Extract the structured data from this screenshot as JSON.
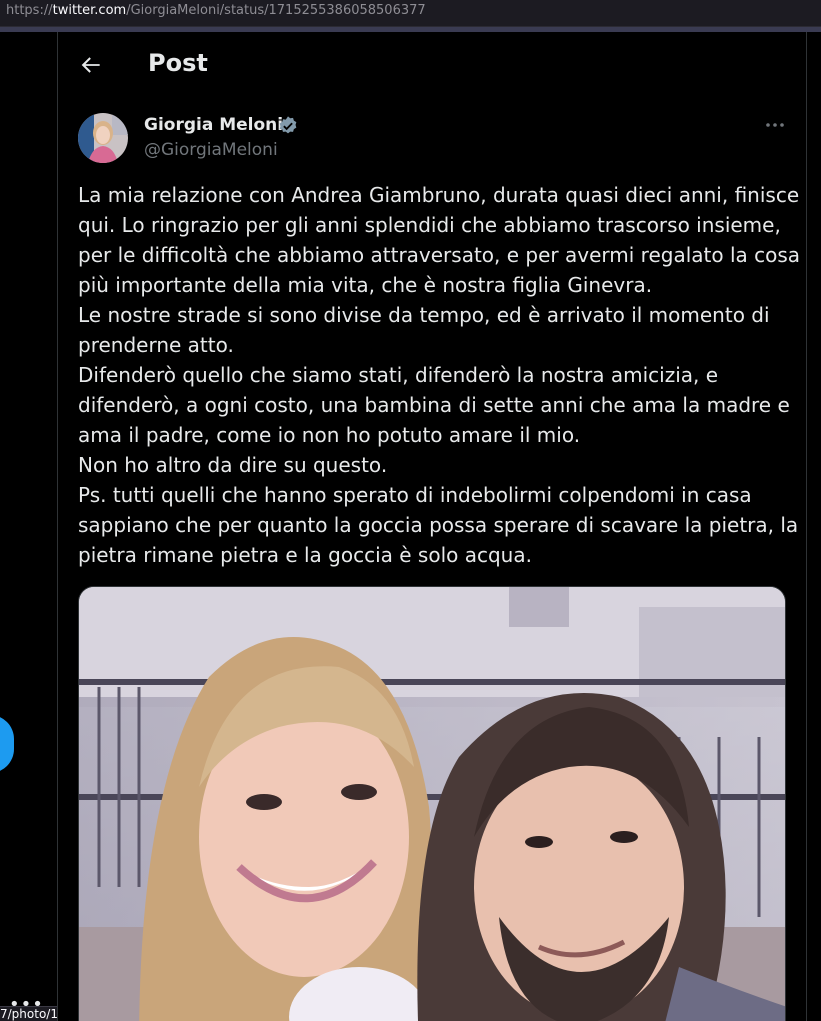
{
  "browser": {
    "url_prefix": "https://",
    "url_host": "twitter.com",
    "url_path": "/GiorgiaMeloni/status/1715255386058506377",
    "status_link": "7/photo/1"
  },
  "header": {
    "title": "Post",
    "back_icon": "arrow-left-icon"
  },
  "post": {
    "author_name": "Giorgia Meloni",
    "handle": "@GiorgiaMeloni",
    "verified_icon": "verified-badge-icon",
    "more_icon": "more-horizontal-icon",
    "lines": [
      "La mia relazione con Andrea Giambruno, durata quasi dieci anni, finisce",
      "qui. Lo ringrazio per gli anni splendidi che abbiamo trascorso insieme,",
      "per le difficoltà che abbiamo attraversato, e per avermi regalato la cosa",
      "più importante della mia vita, che è nostra figlia Ginevra.",
      "Le nostre strade si sono divise da tempo, ed è arrivato il momento di",
      "prenderne atto.",
      "Difenderò quello che siamo stati, difenderò la nostra amicizia, e",
      "difenderò, a ogni costo, una bambina di sette anni che ama la madre e",
      "ama il padre, come io non ho potuto amare il mio.",
      "Non ho altro da dire su questo.",
      "Ps. tutti quelli che hanno sperato di indebolirmi colpendomi in casa",
      "sappiano che per quanto la goccia possa sperare di scavare la pietra, la",
      "pietra rimane pietra e la goccia è solo acqua."
    ]
  },
  "colors": {
    "background": "#000000",
    "text": "#e7e9ea",
    "secondary_text": "#71767b",
    "accent": "#1d9bf0",
    "border": "#2f3336"
  }
}
